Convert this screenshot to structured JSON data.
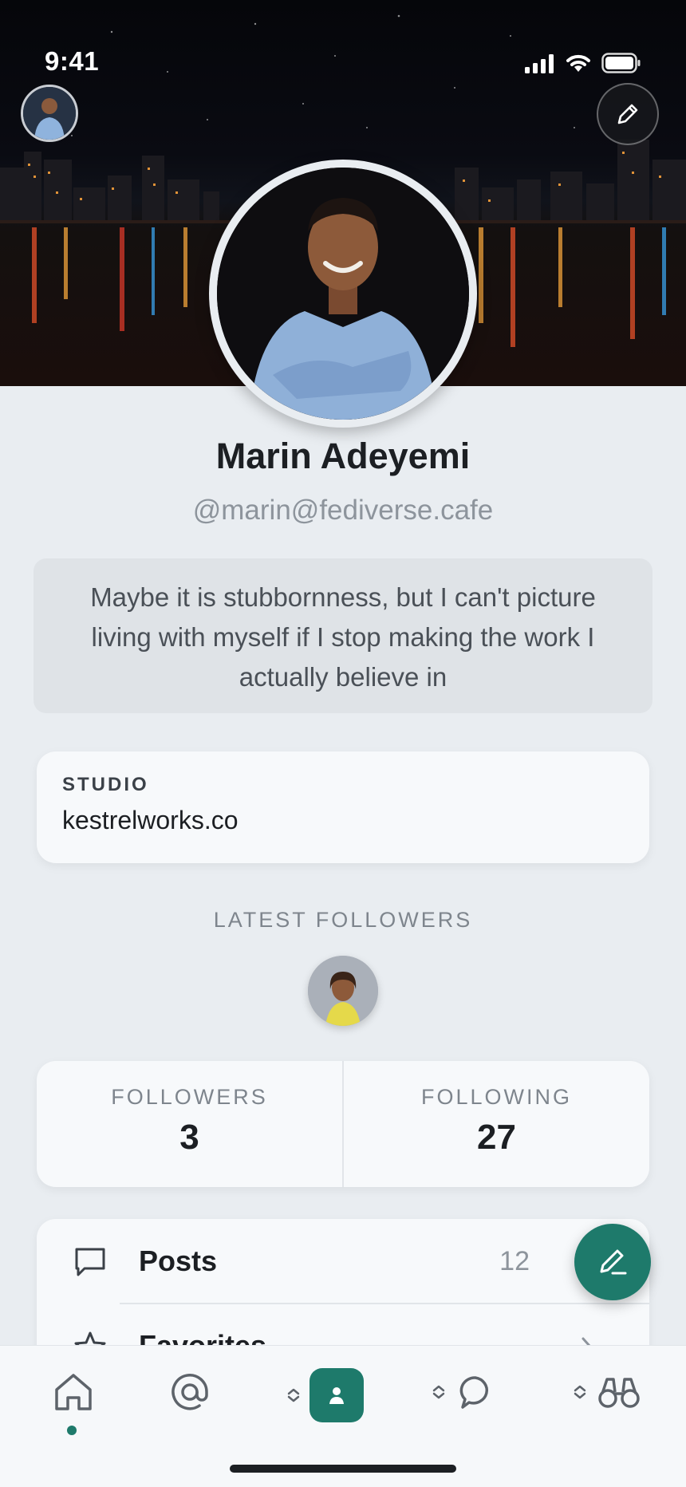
{
  "status_bar": {
    "time": "9:41"
  },
  "profile": {
    "display_name": "Marin Adeyemi",
    "handle": "@marin@fediverse.cafe",
    "bio": "Maybe it is stubbornness, but I can't picture living with myself if I stop making the work I actually believe in"
  },
  "fields": [
    {
      "label": "STUDIO",
      "value": "kestrelworks.co"
    }
  ],
  "latest_followers": {
    "label": "LATEST FOLLOWERS"
  },
  "stats": {
    "followers_label": "FOLLOWERS",
    "followers_value": "3",
    "following_label": "FOLLOWING",
    "following_value": "27"
  },
  "menu": [
    {
      "label": "Posts",
      "count": "12",
      "icon": "speech-bubble-icon"
    },
    {
      "label": "Favorites",
      "count": "",
      "icon": "star-icon"
    }
  ],
  "tabbar": {
    "items": [
      {
        "name": "home",
        "icon": "home-icon",
        "active": true
      },
      {
        "name": "mentions",
        "icon": "at-icon"
      },
      {
        "name": "profile",
        "icon": "person-icon",
        "selected": true
      },
      {
        "name": "conversations",
        "icon": "chat-bubble-icon"
      },
      {
        "name": "explore",
        "icon": "binoculars-icon"
      }
    ]
  },
  "colors": {
    "accent": "#1e7a6b",
    "background": "#e9edf1",
    "card": "#f7f9fb"
  }
}
